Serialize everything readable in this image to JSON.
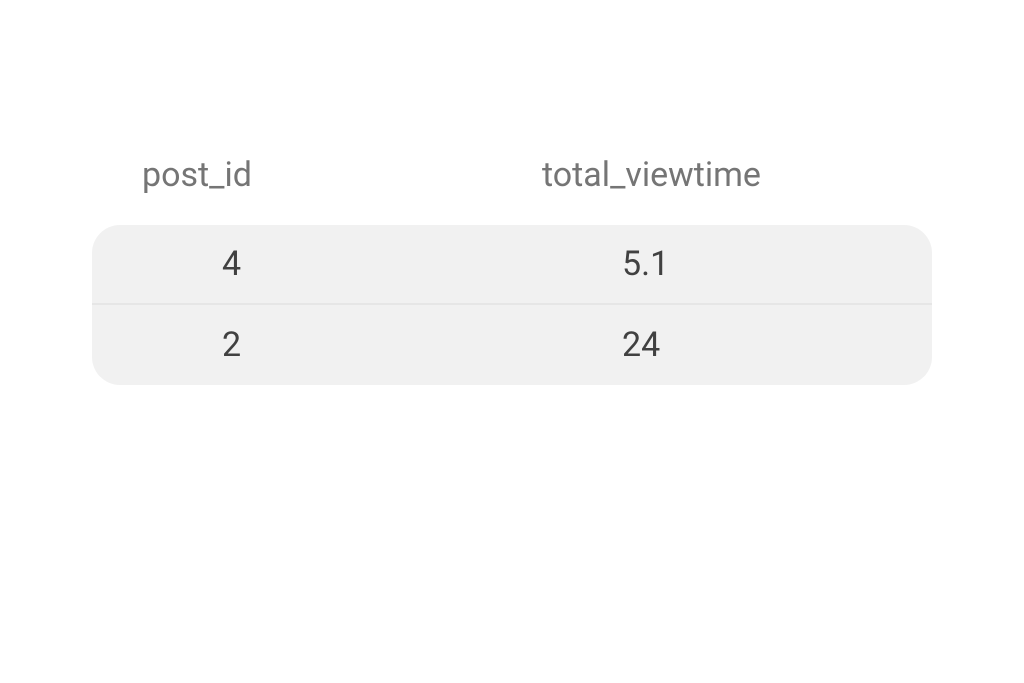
{
  "table": {
    "columns": [
      {
        "label": "post_id"
      },
      {
        "label": "total_viewtime"
      }
    ],
    "rows": [
      {
        "post_id": "4",
        "total_viewtime": "5.1"
      },
      {
        "post_id": "2",
        "total_viewtime": "24"
      }
    ]
  }
}
